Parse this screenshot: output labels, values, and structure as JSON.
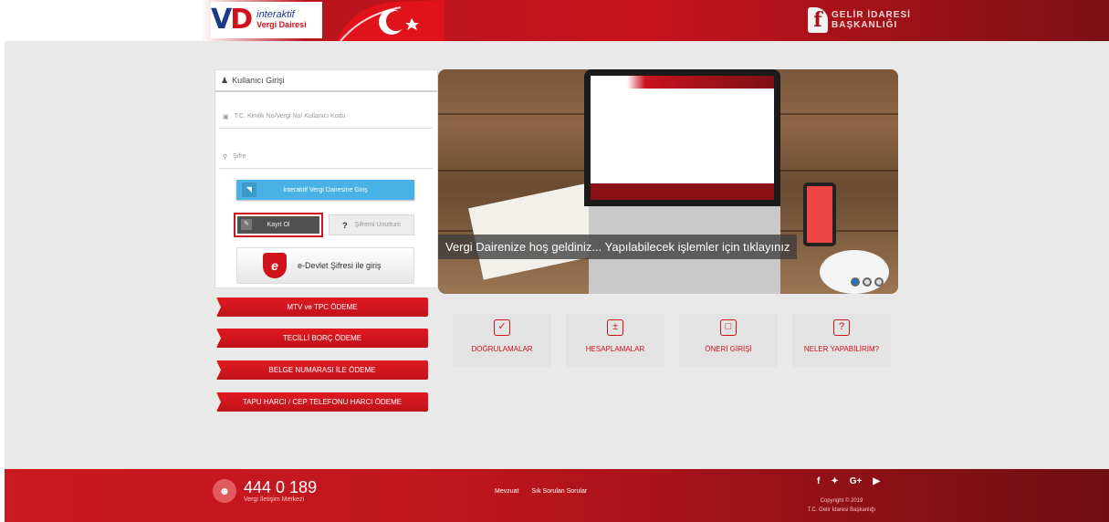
{
  "header": {
    "logo_mark_v": "V",
    "logo_mark_d": "D",
    "logo_line1": "interaktif",
    "logo_line2": "Vergi Dairesi",
    "gib_line1": "GELİR İDARESİ",
    "gib_line2": "BAŞKANLIĞI"
  },
  "login": {
    "title": "Kullanıcı Girişi",
    "username_placeholder": "T.C. Kimlik No/Vergi No/ Kullanıcı Kodu",
    "password_placeholder": "Şifre",
    "login_button": "İnteraktif Vergi Dairesine Giriş",
    "register_button": "Kayıt Ol",
    "forgot_button": "Şifremi Unuttum",
    "edevlet_button": "e-Devlet Şifresi ile giriş"
  },
  "payments": [
    "MTV ve TPC ÖDEME",
    "TECİLLİ BORÇ ÖDEME",
    "BELGE NUMARASI İLE ÖDEME",
    "TAPU HARCI / CEP TELEFONU HARCI ÖDEME"
  ],
  "slider": {
    "caption": "Vergi Dairenize hoş geldiniz... Yapılabilecek işlemler için tıklayınız",
    "active_index": 0,
    "slide_count": 3
  },
  "tiles": [
    {
      "label": "DOĞRULAMALAR",
      "icon": "search-check-icon"
    },
    {
      "label": "HESAPLAMALAR",
      "icon": "calculator-icon"
    },
    {
      "label": "ÖNERİ GİRİŞİ",
      "icon": "inbox-icon"
    },
    {
      "label": "NELER YAPABİLİRİM?",
      "icon": "question-monitor-icon"
    }
  ],
  "footer": {
    "phone": "444 0 189",
    "phone_label": "Vergi İletişim Merkezi",
    "link1": "Mevzuat",
    "link2": "Sık Sorulan Sorular",
    "copyright": "Copyright © 2019",
    "org": "T.C. Gelir İdaresi Başkanlığı"
  },
  "colors": {
    "brand_red": "#d0121b",
    "login_blue": "#48b1e5"
  }
}
